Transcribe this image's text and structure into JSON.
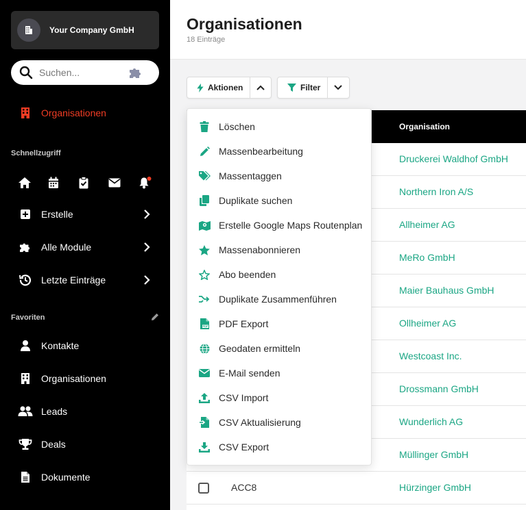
{
  "colors": {
    "accent": "#1ba684",
    "active_nav": "#f03c24",
    "sidebar_bg": "#000000"
  },
  "sidebar": {
    "company": "Your Company GmbH",
    "search_placeholder": "Suchen...",
    "active_item": "Organisationen",
    "quick_access_title": "Schnellzugriff",
    "quick_icons": [
      "home-icon",
      "calendar-icon",
      "clipboard-check-icon",
      "mail-icon",
      "bell-icon"
    ],
    "menus": [
      {
        "label": "Erstelle",
        "icon": "plus-square-icon"
      },
      {
        "label": "Alle Module",
        "icon": "puzzle-icon"
      },
      {
        "label": "Letzte Einträge",
        "icon": "history-icon"
      }
    ],
    "favorites_title": "Favoriten",
    "favorites": [
      {
        "label": "Kontakte",
        "icon": "user-icon"
      },
      {
        "label": "Organisationen",
        "icon": "building-icon"
      },
      {
        "label": "Leads",
        "icon": "users-icon"
      },
      {
        "label": "Deals",
        "icon": "trophy-icon"
      },
      {
        "label": "Dokumente",
        "icon": "file-icon"
      }
    ]
  },
  "header": {
    "title": "Organisationen",
    "count": "18 Einträge"
  },
  "toolbar": {
    "actions_label": "Aktionen",
    "filter_label": "Filter"
  },
  "actions_menu": [
    {
      "label": "Löschen",
      "icon": "trash-icon"
    },
    {
      "label": "Massenbearbeitung",
      "icon": "pencil-icon"
    },
    {
      "label": "Massentaggen",
      "icon": "tags-icon"
    },
    {
      "label": "Duplikate suchen",
      "icon": "copy-icon"
    },
    {
      "label": "Erstelle Google Maps Routenplan",
      "icon": "map-icon"
    },
    {
      "label": "Massenabonnieren",
      "icon": "star-icon"
    },
    {
      "label": "Abo beenden",
      "icon": "star-outline-icon"
    },
    {
      "label": "Duplikate Zusammenführen",
      "icon": "merge-icon"
    },
    {
      "label": "PDF Export",
      "icon": "pdf-icon"
    },
    {
      "label": "Geodaten ermitteln",
      "icon": "globe-icon"
    },
    {
      "label": "E-Mail senden",
      "icon": "mail-icon"
    },
    {
      "label": "CSV Import",
      "icon": "upload-icon"
    },
    {
      "label": "CSV Aktualisierung",
      "icon": "file-import-icon"
    },
    {
      "label": "CSV Export",
      "icon": "download-icon"
    }
  ],
  "table": {
    "org_header": "Organisation",
    "rows": [
      {
        "id": "",
        "org": "Druckerei Waldhof GmbH"
      },
      {
        "id": "",
        "org": "Northern Iron A/S"
      },
      {
        "id": "",
        "org": "Allheimer AG"
      },
      {
        "id": "",
        "org": "MeRo GmbH"
      },
      {
        "id": "",
        "org": "Maier Bauhaus GmbH"
      },
      {
        "id": "",
        "org": "Ollheimer AG"
      },
      {
        "id": "",
        "org": "Westcoast Inc."
      },
      {
        "id": "",
        "org": "Drossmann GmbH"
      },
      {
        "id": "",
        "org": "Wunderlich AG"
      },
      {
        "id": "",
        "org": "Müllinger GmbH"
      },
      {
        "id": "ACC8",
        "org": "Hürzinger GmbH"
      }
    ]
  }
}
